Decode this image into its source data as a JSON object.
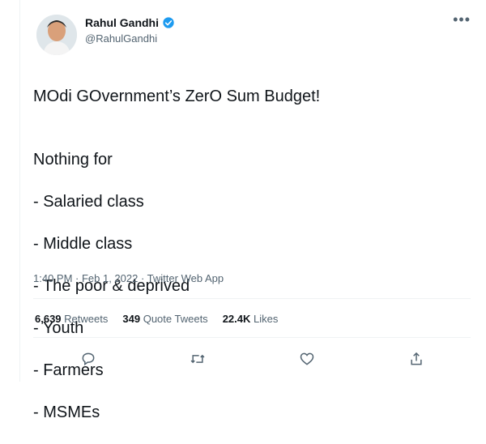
{
  "author": {
    "name": "Rahul Gandhi",
    "handle": "@RahulGandhi",
    "verified": true
  },
  "tweet": {
    "headline": "MOdi GOvernment’s ZerO Sum Budget!",
    "intro": "Nothing for",
    "items": [
      "- Salaried class",
      "- Middle class",
      "- The poor & deprived",
      "- Youth",
      "- Farmers",
      "- MSMEs"
    ],
    "timestamp": "1:40 PM · Feb 1, 2022 · Twitter Web App"
  },
  "stats": {
    "retweets_count": "6,639",
    "retweets_label": "Retweets",
    "quotes_count": "349",
    "quotes_label": "Quote Tweets",
    "likes_count": "22.4K",
    "likes_label": "Likes"
  },
  "actions": {
    "reply_icon": "reply-icon",
    "retweet_icon": "retweet-icon",
    "like_icon": "like-icon",
    "share_icon": "share-icon"
  },
  "colors": {
    "verified": "#1d9bf0",
    "secondary_text": "#536471",
    "primary_text": "#0f1419"
  }
}
